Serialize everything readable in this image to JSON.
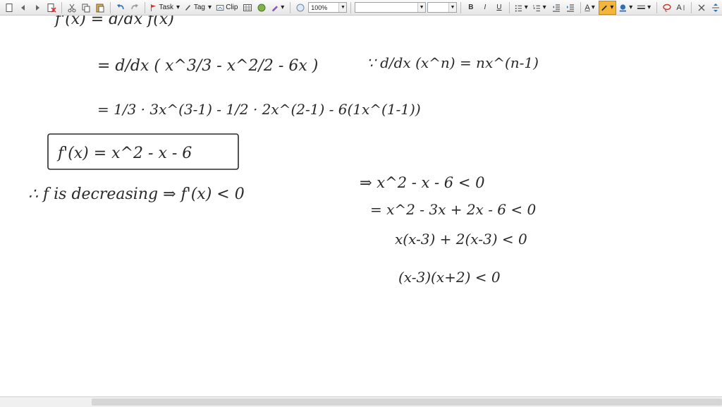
{
  "toolbar": {
    "task_label": "Task",
    "tag_label": "Tag",
    "clip_label": "Clip",
    "zoom": "100%",
    "font_name": "",
    "font_size": "",
    "bold": "B",
    "italic": "I",
    "underline": "U",
    "text_color": "A",
    "font_aa": "A"
  },
  "canvas": {
    "lines": [
      "f'(x) = d/dx f(x)",
      "= d/dx ( x^3/3 - x^2/2 - 6x )",
      "∵ d/dx (x^n) = nx^(n-1)",
      "= 1/3 · 3x^(3-1) - 1/2 · 2x^(2-1) - 6(1x^(1-1))",
      "f'(x) = x^2 - x - 6",
      "∴ f is decreasing ⇒ f'(x) < 0",
      "⇒ x^2 - x - 6 < 0",
      "= x^2 - 3x + 2x - 6 < 0",
      "x(x-3) + 2(x-3) < 0",
      "(x-3)(x+2) < 0"
    ]
  }
}
